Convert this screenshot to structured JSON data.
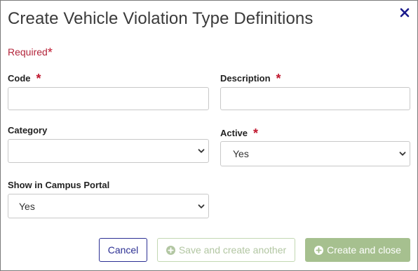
{
  "dialog": {
    "title": "Create Vehicle Violation Type Definitions",
    "required_note": "Required",
    "required_marker": "*"
  },
  "fields": {
    "code": {
      "label": "Code",
      "value": ""
    },
    "description": {
      "label": "Description",
      "value": ""
    },
    "category": {
      "label": "Category",
      "value": ""
    },
    "active": {
      "label": "Active",
      "value": "Yes"
    },
    "show_in_portal": {
      "label": "Show in Campus Portal",
      "value": "Yes"
    }
  },
  "buttons": {
    "cancel": "Cancel",
    "save_and_create_another": "Save and create another",
    "create_and_close": "Create and close"
  },
  "colors": {
    "close_icon": "#1a1a8c",
    "required": "#c0182f",
    "cancel_border": "#2b2f93",
    "save_another_text": "#b2c6a2",
    "create_close_bg": "#a6c08f"
  },
  "icons": {
    "close": "close-icon",
    "select_caret": "chevron-down-icon",
    "add": "plus-circle-icon"
  }
}
